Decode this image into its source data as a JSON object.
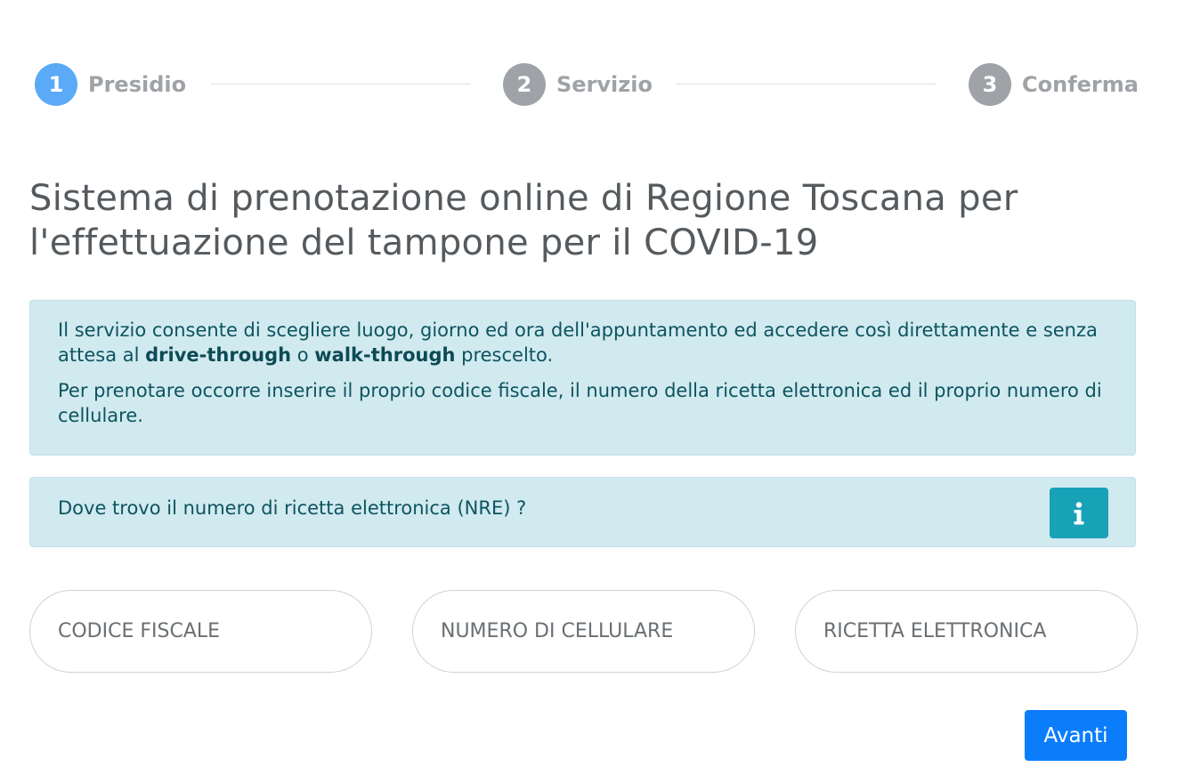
{
  "stepper": {
    "steps": [
      {
        "number": "1",
        "label": "Presidio",
        "active": true
      },
      {
        "number": "2",
        "label": "Servizio",
        "active": false
      },
      {
        "number": "3",
        "label": "Conferma",
        "active": false
      }
    ]
  },
  "title": "Sistema di prenotazione online di Regione Toscana per l'effettuazione del tampone per il COVID-19",
  "info": {
    "p1_part1": "Il servizio consente di scegliere luogo, giorno ed ora dell'appuntamento ed accedere così direttamente e senza attesa al ",
    "p1_bold1": "drive-through",
    "p1_part2": " o ",
    "p1_bold2": "walk-through",
    "p1_part3": " prescelto.",
    "p2": "Per prenotare occorre inserire il proprio codice fiscale, il numero della ricetta elettronica ed il proprio numero di cellulare."
  },
  "nre": {
    "question": "Dove trovo il numero di ricetta elettronica (NRE) ?",
    "info_icon": "info-icon"
  },
  "form": {
    "codice_fiscale": {
      "value": "",
      "placeholder": "CODICE FISCALE"
    },
    "cellulare": {
      "value": "",
      "placeholder": "NUMERO DI CELLULARE"
    },
    "ricetta": {
      "value": "",
      "placeholder": "RICETTA ELETTRONICA"
    }
  },
  "actions": {
    "next_label": "Avanti"
  },
  "colors": {
    "active_step": "#5aaaf7",
    "inactive_step": "#9fa3a7",
    "alert_bg": "#d1eaef",
    "alert_text": "#0c5460",
    "info_button": "#17a2b8",
    "primary_button": "#0b7dfb"
  }
}
